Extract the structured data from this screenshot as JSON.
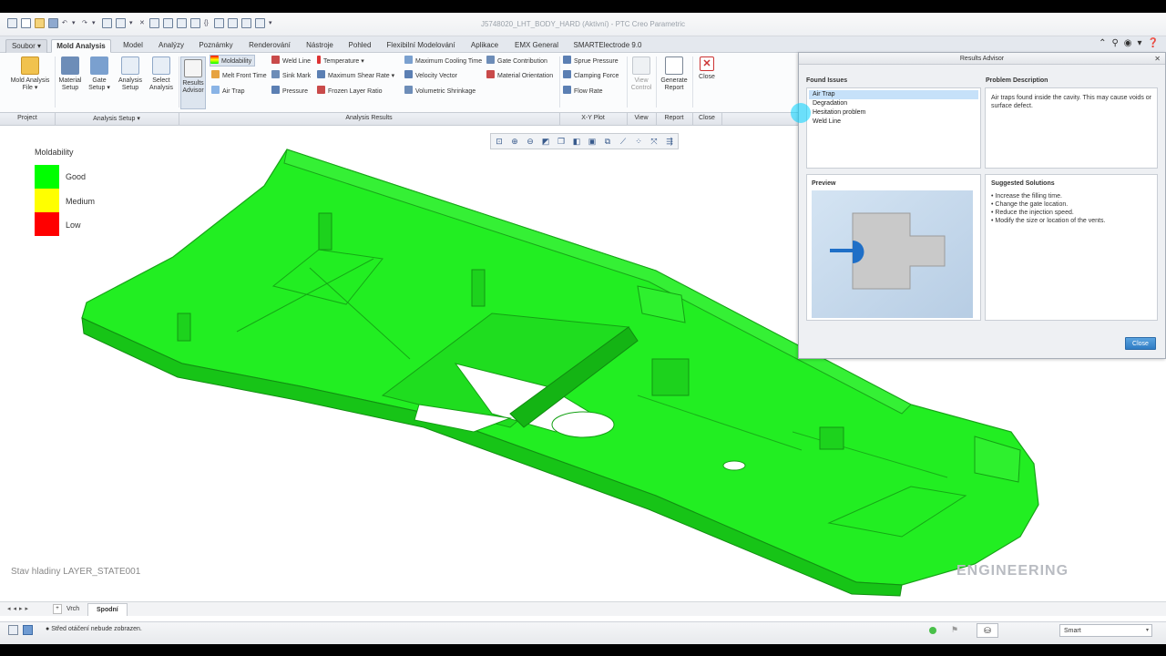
{
  "window": {
    "title": "J5748020_LHT_BODY_HARD (Aktivní) - PTC Creo Parametric"
  },
  "tabs": [
    {
      "label": "Soubor ▾"
    },
    {
      "label": "Mold Analysis"
    },
    {
      "label": "Model"
    },
    {
      "label": "Analýzy"
    },
    {
      "label": "Poznámky"
    },
    {
      "label": "Renderování"
    },
    {
      "label": "Nástroje"
    },
    {
      "label": "Pohled"
    },
    {
      "label": "Flexibilní Modelování"
    },
    {
      "label": "Aplikace"
    },
    {
      "label": "EMX General"
    },
    {
      "label": "SMARTElectrode 9.0"
    }
  ],
  "ribbon": {
    "project": {
      "mold_analysis_file": "Mold Analysis\nFile ▾"
    },
    "setup": {
      "material_setup": "Material\nSetup",
      "gate_setup": "Gate\nSetup ▾",
      "analysis_setup": "Analysis\nSetup",
      "select_analysis": "Select\nAnalysis"
    },
    "results": {
      "results_advisor": "Results\nAdvisor",
      "col1": [
        "Moldability",
        "Melt Front Time",
        "Air Trap"
      ],
      "col2": [
        "Weld Line",
        "Sink Mark",
        "Pressure"
      ],
      "col3": [
        "Temperature ▾",
        "Maximum Shear Rate ▾",
        "Frozen Layer Ratio"
      ],
      "col4": [
        "Maximum Cooling Time",
        "Velocity Vector",
        "Volumetric Shrinkage"
      ],
      "col5": [
        "Gate Contribution",
        "Material Orientation"
      ],
      "col6": [
        "Sprue Pressure",
        "Clamping Force",
        "Flow Rate"
      ]
    },
    "view_control": "View\nControl",
    "generate_report": "Generate\nReport",
    "close": "Close",
    "groups": {
      "project": "Project",
      "analysis_setup": "Analysis Setup ▾",
      "analysis_results": "Analysis Results",
      "xy_plot": "X-Y Plot",
      "view": "View",
      "report": "Report",
      "close": "Close"
    }
  },
  "legend": {
    "title": "Moldability",
    "items": [
      {
        "label": "Good",
        "color": "#00ff00"
      },
      {
        "label": "Medium",
        "color": "#ffff00"
      },
      {
        "label": "Low",
        "color": "#ff0000"
      }
    ]
  },
  "viewport": {
    "layer_state": "Stav hladiny LAYER_STATE001",
    "watermark": "ENGINEERING",
    "part_color": "#22ee22"
  },
  "advisor": {
    "title": "Results Advisor",
    "found_issues_title": "Found Issues",
    "issues": [
      "Air Trap",
      "Degradation",
      "Hesitation problem",
      "Weld Line"
    ],
    "selected_issue": "Air Trap",
    "problem_title": "Problem Description",
    "problem_text": "Air traps found inside the cavity. This may cause voids or surface defect.",
    "preview_title": "Preview",
    "solutions_title": "Suggested Solutions",
    "solutions": [
      "Increase the filling time.",
      "Change the gate location.",
      "Reduce the injection speed.",
      "Modify the size or location of the vents."
    ],
    "close_button": "Close"
  },
  "bottom_tabs": [
    "Vrch",
    "Spodní"
  ],
  "status": {
    "message": "Střed otáčení nebude zobrazen.",
    "filter_value": "Smart"
  }
}
